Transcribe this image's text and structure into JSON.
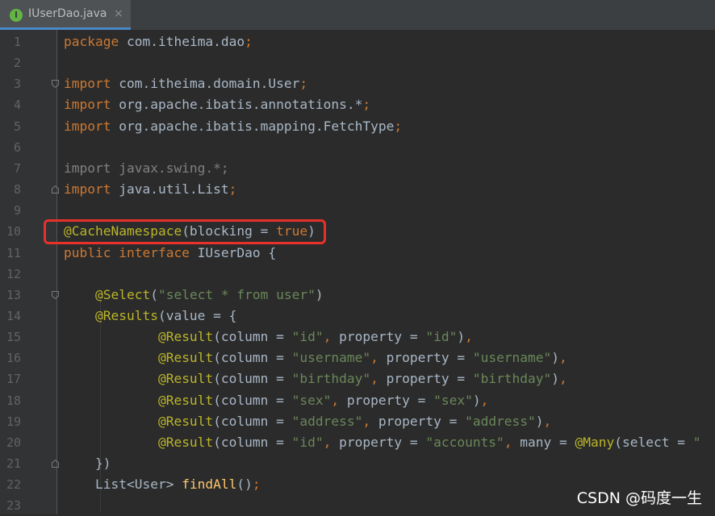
{
  "colors": {
    "keyword": "#cc7832",
    "annotation": "#bbb529",
    "string": "#6a8759",
    "text": "#a9b7c6",
    "method": "#ffc66d",
    "unused": "#808080",
    "highlight_box": "#e8312b",
    "tab_icon": "#62b543"
  },
  "tab": {
    "icon_letter": "I",
    "title": "IUserDao.java",
    "close": "×"
  },
  "watermark": "CSDN @码度一生",
  "lines": [
    {
      "n": "1",
      "tokens": [
        [
          "kw",
          "package"
        ],
        [
          "tx",
          " com.itheima.dao"
        ],
        [
          "kw",
          ";"
        ]
      ]
    },
    {
      "n": "2",
      "tokens": []
    },
    {
      "n": "3",
      "tokens": [
        [
          "kw",
          "import"
        ],
        [
          "tx",
          " com.itheima.domain.User"
        ],
        [
          "kw",
          ";"
        ]
      ]
    },
    {
      "n": "4",
      "tokens": [
        [
          "kw",
          "import"
        ],
        [
          "tx",
          " org.apache.ibatis.annotations.*"
        ],
        [
          "kw",
          ";"
        ]
      ]
    },
    {
      "n": "5",
      "tokens": [
        [
          "kw",
          "import"
        ],
        [
          "tx",
          " org.apache.ibatis.mapping.FetchType"
        ],
        [
          "kw",
          ";"
        ]
      ]
    },
    {
      "n": "6",
      "tokens": []
    },
    {
      "n": "7",
      "tokens": [
        [
          "un",
          "import javax.swing.*;"
        ]
      ]
    },
    {
      "n": "8",
      "tokens": [
        [
          "kw",
          "import"
        ],
        [
          "tx",
          " java.util.List"
        ],
        [
          "kw",
          ";"
        ]
      ]
    },
    {
      "n": "9",
      "tokens": []
    },
    {
      "n": "10",
      "tokens": [
        [
          "an",
          "@CacheNamespace"
        ],
        [
          "tx",
          "(blocking = "
        ],
        [
          "kw",
          "true"
        ],
        [
          "tx",
          ")"
        ]
      ]
    },
    {
      "n": "11",
      "tokens": [
        [
          "kw",
          "public interface"
        ],
        [
          "tx",
          " IUserDao {"
        ]
      ]
    },
    {
      "n": "12",
      "tokens": []
    },
    {
      "n": "13",
      "tokens": [
        [
          "tx",
          "    "
        ],
        [
          "an",
          "@Select"
        ],
        [
          "tx",
          "("
        ],
        [
          "st",
          "\"select * from user\""
        ],
        [
          "tx",
          ")"
        ]
      ]
    },
    {
      "n": "14",
      "tokens": [
        [
          "tx",
          "    "
        ],
        [
          "an",
          "@Results"
        ],
        [
          "tx",
          "(value = {"
        ]
      ]
    },
    {
      "n": "15",
      "tokens": [
        [
          "tx",
          "            "
        ],
        [
          "an",
          "@Result"
        ],
        [
          "tx",
          "(column = "
        ],
        [
          "st",
          "\"id\""
        ],
        [
          "kw",
          ","
        ],
        [
          "tx",
          " property = "
        ],
        [
          "st",
          "\"id\""
        ],
        [
          "tx",
          ")"
        ],
        [
          "kw",
          ","
        ]
      ]
    },
    {
      "n": "16",
      "tokens": [
        [
          "tx",
          "            "
        ],
        [
          "an",
          "@Result"
        ],
        [
          "tx",
          "(column = "
        ],
        [
          "st",
          "\"username\""
        ],
        [
          "kw",
          ","
        ],
        [
          "tx",
          " property = "
        ],
        [
          "st",
          "\"username\""
        ],
        [
          "tx",
          ")"
        ],
        [
          "kw",
          ","
        ]
      ]
    },
    {
      "n": "17",
      "tokens": [
        [
          "tx",
          "            "
        ],
        [
          "an",
          "@Result"
        ],
        [
          "tx",
          "(column = "
        ],
        [
          "st",
          "\"birthday\""
        ],
        [
          "kw",
          ","
        ],
        [
          "tx",
          " property = "
        ],
        [
          "st",
          "\"birthday\""
        ],
        [
          "tx",
          ")"
        ],
        [
          "kw",
          ","
        ]
      ]
    },
    {
      "n": "18",
      "tokens": [
        [
          "tx",
          "            "
        ],
        [
          "an",
          "@Result"
        ],
        [
          "tx",
          "(column = "
        ],
        [
          "st",
          "\"sex\""
        ],
        [
          "kw",
          ","
        ],
        [
          "tx",
          " property = "
        ],
        [
          "st",
          "\"sex\""
        ],
        [
          "tx",
          ")"
        ],
        [
          "kw",
          ","
        ]
      ]
    },
    {
      "n": "19",
      "tokens": [
        [
          "tx",
          "            "
        ],
        [
          "an",
          "@Result"
        ],
        [
          "tx",
          "(column = "
        ],
        [
          "st",
          "\"address\""
        ],
        [
          "kw",
          ","
        ],
        [
          "tx",
          " property = "
        ],
        [
          "st",
          "\"address\""
        ],
        [
          "tx",
          ")"
        ],
        [
          "kw",
          ","
        ]
      ]
    },
    {
      "n": "20",
      "tokens": [
        [
          "tx",
          "            "
        ],
        [
          "an",
          "@Result"
        ],
        [
          "tx",
          "(column = "
        ],
        [
          "st",
          "\"id\""
        ],
        [
          "kw",
          ","
        ],
        [
          "tx",
          " property = "
        ],
        [
          "st",
          "\"accounts\""
        ],
        [
          "kw",
          ","
        ],
        [
          "tx",
          " many = "
        ],
        [
          "an",
          "@Many"
        ],
        [
          "tx",
          "(select = "
        ],
        [
          "st",
          "\""
        ]
      ]
    },
    {
      "n": "21",
      "tokens": [
        [
          "tx",
          "    })"
        ]
      ]
    },
    {
      "n": "22",
      "tokens": [
        [
          "tx",
          "    List<User> "
        ],
        [
          "me",
          "findAll"
        ],
        [
          "tx",
          "()"
        ],
        [
          "kw",
          ";"
        ]
      ]
    },
    {
      "n": "23",
      "tokens": []
    }
  ]
}
